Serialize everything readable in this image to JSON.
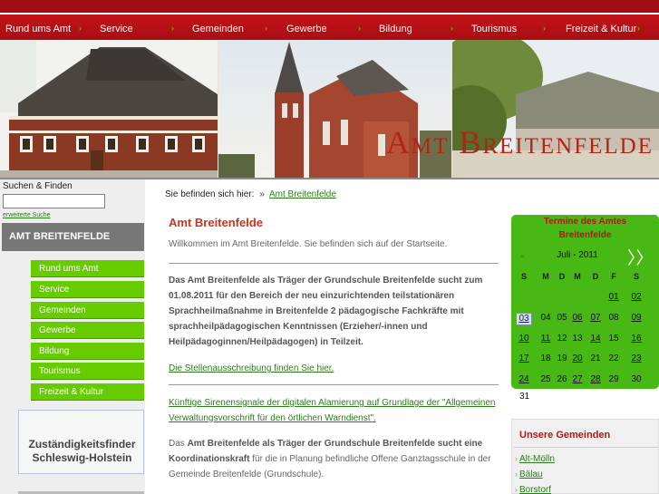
{
  "nav": {
    "items": [
      "Rund ums Amt",
      "Service",
      "Gemeinden",
      "Gewerbe",
      "Bildung",
      "Tourismus",
      "Freizeit & Kultur"
    ],
    "arrow": "›"
  },
  "banner": {
    "title": "Amt Breitenfelde"
  },
  "search": {
    "label": "Suchen & Finden",
    "advanced": "erweiterte Suche",
    "value": ""
  },
  "sidebar": {
    "header": "AMT BREITENFELDE",
    "items": [
      "Rund ums Amt",
      "Service",
      "Gemeinden",
      "Gewerbe",
      "Bildung",
      "Tourismus",
      "Freizeit & Kultur"
    ],
    "finder": {
      "line1": "Zuständigkeitsfinder",
      "line2": "Schleswig-Holstein"
    }
  },
  "breadcrumb": {
    "label": "Sie befinden sich hier:",
    "sep": "»",
    "current": "Amt Breitenfelde"
  },
  "main": {
    "title": "Amt Breitenfelde",
    "welcome": "Willkommen im Amt Breitenfelde. Sie befinden sich auf der Startseite.",
    "para1": "Das Amt Breitenfelde als Träger der Grundschule Breitenfelde sucht zum 01.08.2011 für den Bereich der neu einzurichtenden teilstationären Sprachheilmaßnahme in Breitenfelde 2 pädagogische Fachkräfte mit sprachheilpädagogischen Kenntnissen (Erzieher/-innen und Heilpädagoginnen/Heilpädagogen) in Teilzeit.",
    "link1": "Die Stellenausschreibung finden Sie hier.",
    "link2": "Künftige Sirenensignale der digitalen Alamierung auf Grundlage der \"Allgemeinen Verwaltungsvorschrift für den örtlichen Warndienst\".",
    "para2_a": "Das ",
    "para2_b": "Amt Breitenfelde als Träger der Grundschule Breitenfelde sucht eine Koordinationskraft",
    "para2_c": " für die in Planung befindliche Offene Ganztagsschule in der Gemeinde Breitenfelde (Grundschule)."
  },
  "calendar": {
    "title1": "Termine des Amtes",
    "title2": "Breitenfelde",
    "prev": "«",
    "next": "〉〉",
    "month": "Juli - 2011",
    "dow": [
      "S",
      "M",
      "D",
      "M",
      "D",
      "F",
      "S"
    ],
    "weeks": [
      [
        "",
        "",
        "",
        "",
        "",
        "01",
        "02"
      ],
      [
        "03",
        "04",
        "05",
        "06",
        "07",
        "08",
        "09"
      ],
      [
        "10",
        "11",
        "12",
        "13",
        "14",
        "15",
        "16"
      ],
      [
        "17",
        "18",
        "19",
        "20",
        "21",
        "22",
        "23"
      ],
      [
        "24",
        "25",
        "26",
        "27",
        "28",
        "29",
        "30"
      ]
    ],
    "linked": [
      "01",
      "02",
      "03",
      "06",
      "07",
      "09",
      "10",
      "11",
      "14",
      "16",
      "17",
      "20",
      "23",
      "24",
      "27",
      "28"
    ],
    "today": "03",
    "last": "31"
  },
  "gemeinden": {
    "title": "Unsere Gemeinden",
    "items": [
      "Alt-Mölln",
      "Bälau",
      "Borstorf"
    ]
  },
  "colors": {
    "nav_red": "#a80e13",
    "accent_green": "#66cc00",
    "title_red": "#cc3318"
  }
}
